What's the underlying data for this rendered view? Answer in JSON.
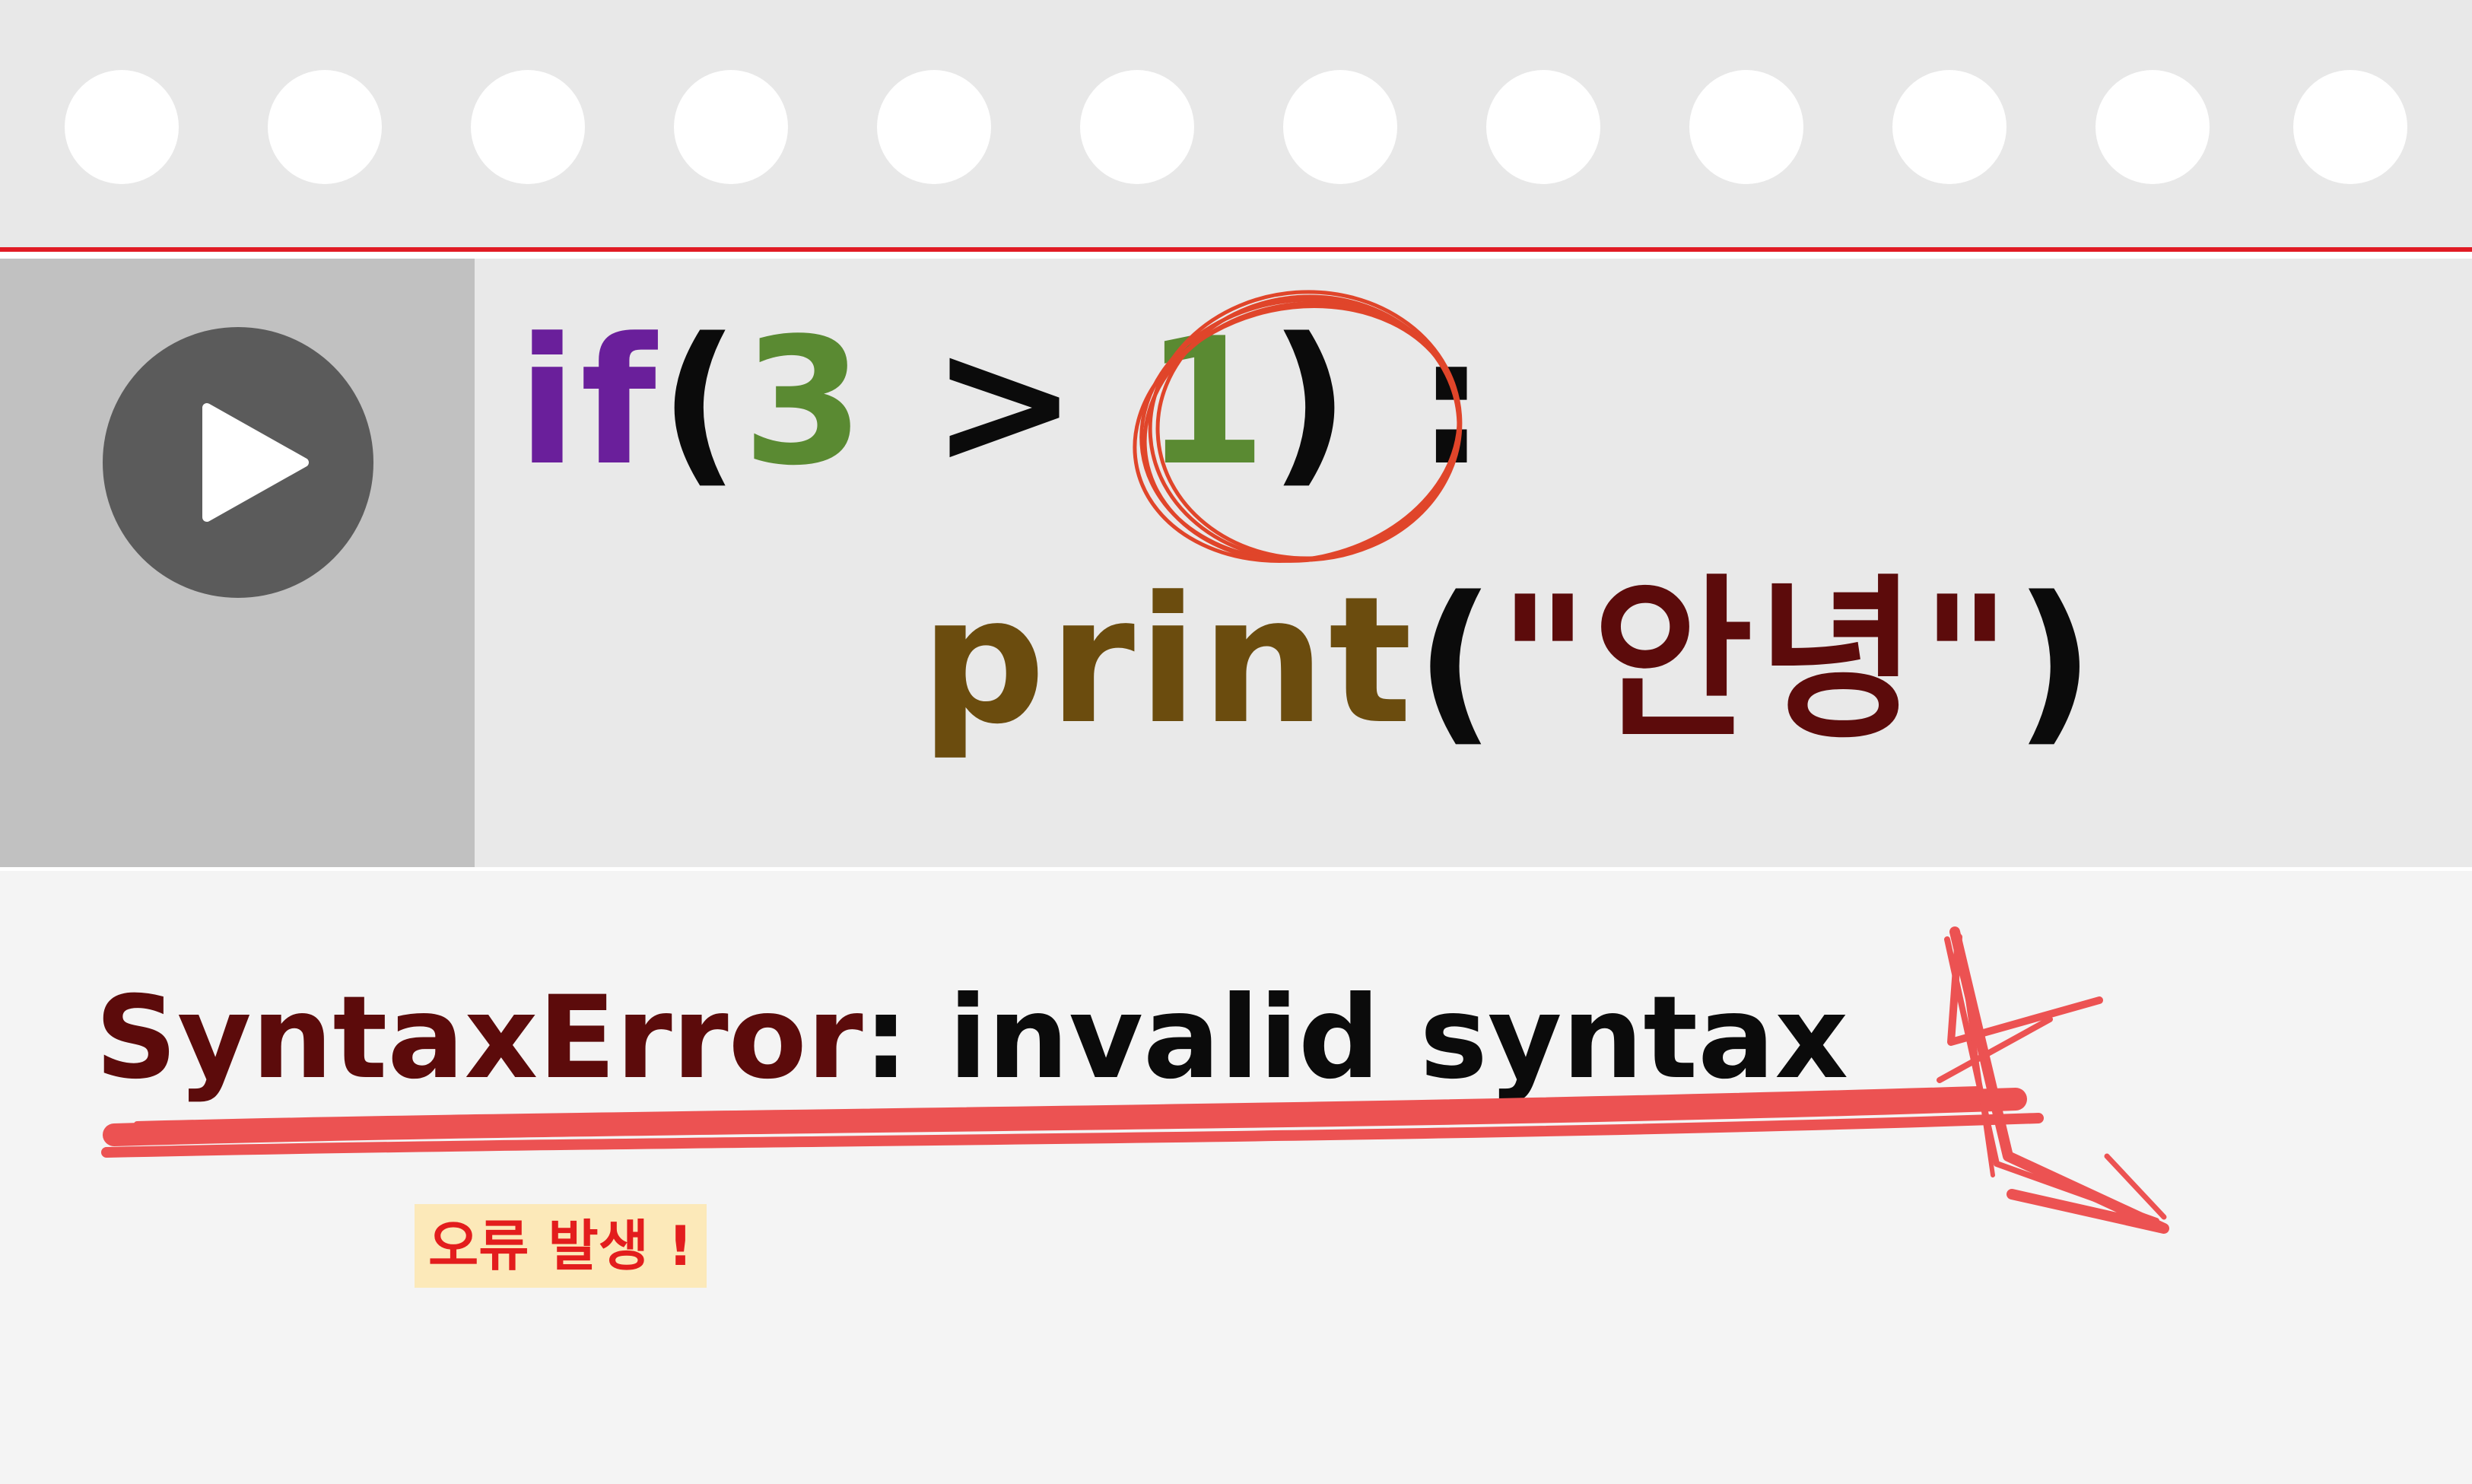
{
  "code": {
    "line1": [
      {
        "text": "if",
        "color": "#6a1f9b"
      },
      {
        "text": "(",
        "color": "#0b0b0b"
      },
      {
        "text": "3",
        "color": "#5a8a32"
      },
      {
        "text": " > ",
        "color": "#0b0b0b"
      },
      {
        "text": "1",
        "color": "#5a8a32"
      },
      {
        "text": ")",
        "color": "#0b0b0b"
      },
      {
        "text": " :",
        "color": "#0b0b0b"
      }
    ],
    "line2": [
      {
        "text": "print",
        "color": "#6b4c0e"
      },
      {
        "text": "(",
        "color": "#0b0b0b"
      },
      {
        "text": "\"안녕\"",
        "color": "#5c0b0b"
      },
      {
        "text": ")",
        "color": "#0b0b0b"
      }
    ]
  },
  "run_button": {
    "icon": "play-icon"
  },
  "output": {
    "error_type": "SyntaxError",
    "error_message": ": invalid syntax"
  },
  "note": {
    "text": "오류 발생 !"
  },
  "colors": {
    "accent_red": "#e01b24",
    "highlight_red": "#ec5252",
    "circle_orange": "#e0452a",
    "note_background": "#fce9b9"
  }
}
